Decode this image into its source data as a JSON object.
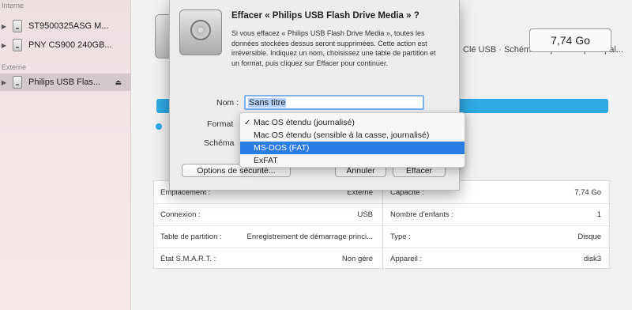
{
  "sidebar": {
    "section_internal": "Interne",
    "section_external": "Externe",
    "internal_items": [
      {
        "label": "ST9500325ASG M..."
      },
      {
        "label": "PNY CS900 240GB..."
      }
    ],
    "external_items": [
      {
        "label": "Philips USB Flas...",
        "eject_glyph": "⏏"
      }
    ]
  },
  "main": {
    "size_box": "7,74 Go",
    "partial_text": "Clé USB · Schéma de partition principal...",
    "info_table": {
      "rows": [
        {
          "left_key": "Emplacement :",
          "left_value": "Externe",
          "right_key": "Capacité :",
          "right_value": "7,74 Go"
        },
        {
          "left_key": "Connexion :",
          "left_value": "USB",
          "right_key": "Nombre d'enfants :",
          "right_value": "1"
        },
        {
          "left_key": "Table de partition :",
          "left_value": "Enregistrement de démarrage princi...",
          "right_key": "Type :",
          "right_value": "Disque"
        },
        {
          "left_key": "État S.M.A.R.T. :",
          "left_value": "Non géré",
          "right_key": "Appareil :",
          "right_value": "disk3"
        }
      ]
    }
  },
  "dialog": {
    "title": "Effacer « Philips USB Flash Drive Media » ?",
    "body": "Si vous effacez « Philips USB Flash Drive Media », toutes les données stockées dessus seront supprimées. Cette action est irréversible. Indiquez un nom, choisissez une table de partition et un format, puis cliquez sur Effacer pour continuer.",
    "name_label": "Nom :",
    "name_value": "Sans titre",
    "format_label": "Format",
    "scheme_label": "Schéma",
    "security_button": "Options de sécurité...",
    "cancel_button": "Annuler",
    "erase_button": "Effacer"
  },
  "format_menu": {
    "items": [
      {
        "label": "Mac OS étendu (journalisé)",
        "checked": true,
        "highlighted": false
      },
      {
        "label": "Mac OS étendu (sensible à la casse, journalisé)",
        "checked": false,
        "highlighted": false
      },
      {
        "label": "MS-DOS (FAT)",
        "checked": false,
        "highlighted": true
      },
      {
        "label": "ExFAT",
        "checked": false,
        "highlighted": false
      }
    ],
    "check_glyph": "✓"
  },
  "colors": {
    "accent": "#2ea9e3",
    "menu_highlight": "#2a7de4",
    "sidebar_selected": "#d3c8cb"
  }
}
